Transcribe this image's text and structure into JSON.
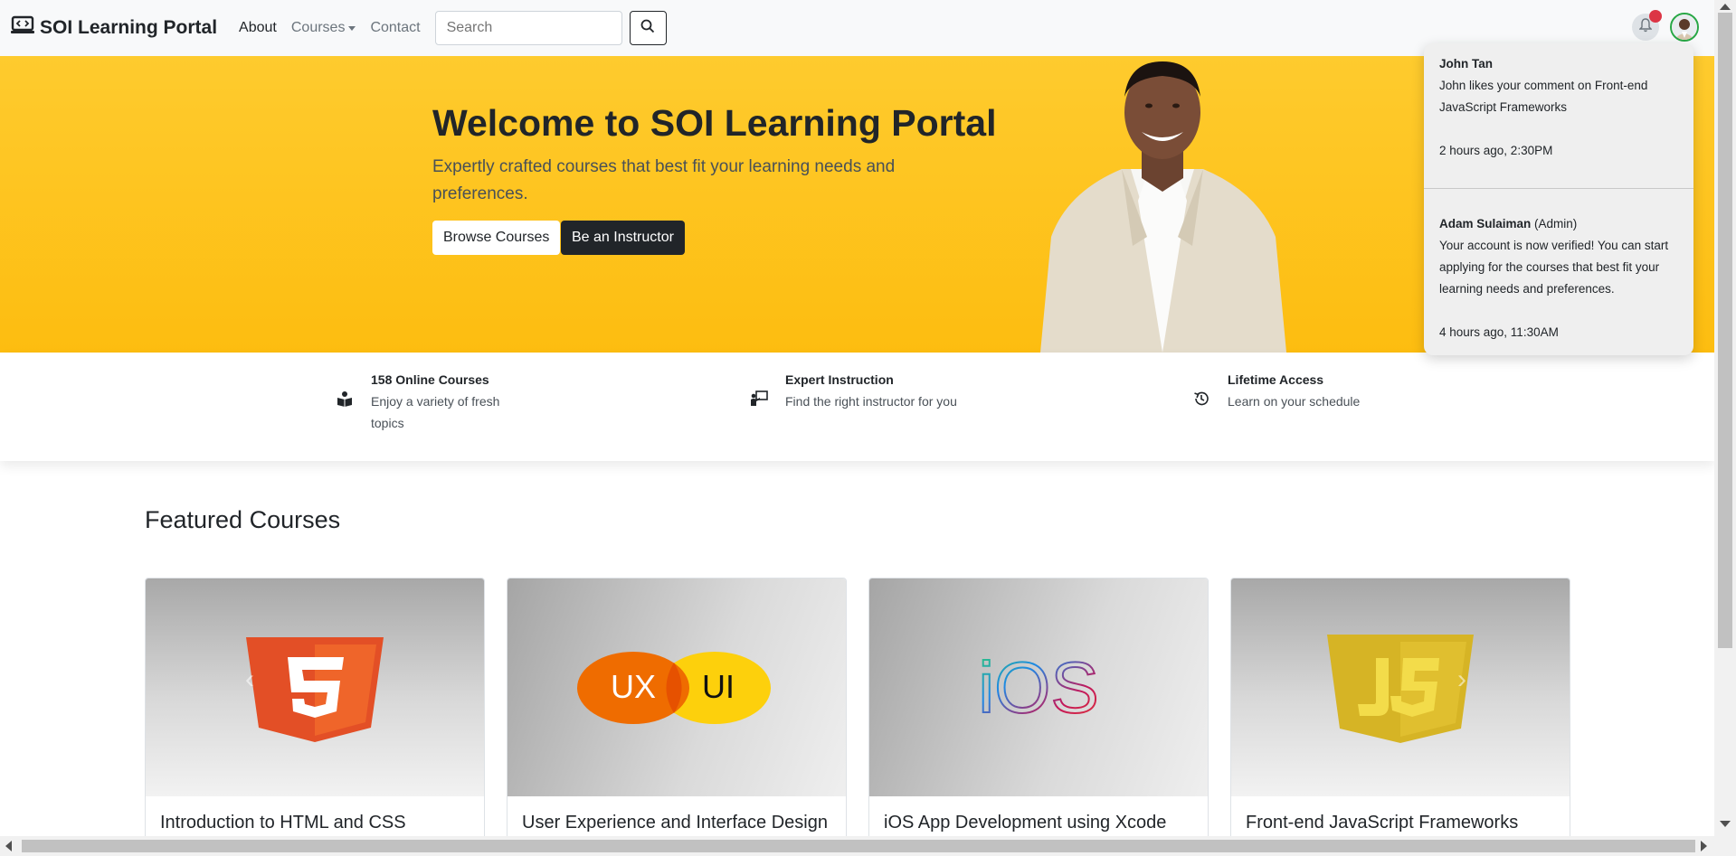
{
  "navbar": {
    "brand": "SOI Learning Portal",
    "links": [
      "About",
      "Courses",
      "Contact"
    ],
    "search_placeholder": "Search"
  },
  "hero": {
    "title": "Welcome to SOI Learning Portal",
    "subtitle": "Expertly crafted courses that best fit your learning needs and preferences.",
    "browse_label": "Browse Courses",
    "instructor_label": "Be an Instructor"
  },
  "features": [
    {
      "title": "158 Online Courses",
      "text": "Enjoy a variety of fresh topics",
      "icon": "book-reader-icon"
    },
    {
      "title": "Expert Instruction",
      "text": "Find the right instructor for you",
      "icon": "chalkboard-teacher-icon"
    },
    {
      "title": "Lifetime Access",
      "text": "Learn on your schedule",
      "icon": "history-icon"
    }
  ],
  "featured": {
    "title": "Featured Courses",
    "courses": [
      {
        "title": "Introduction to HTML and CSS",
        "icon": "html5-logo"
      },
      {
        "title": "User Experience and Interface Design",
        "icon": "ux-ui-logo"
      },
      {
        "title": "iOS App Development using Xcode",
        "icon": "ios-logo"
      },
      {
        "title": "Front-end JavaScript Frameworks",
        "icon": "js-logo"
      }
    ]
  },
  "notifications": [
    {
      "name": "John Tan",
      "role": "",
      "message": "John likes your comment on Front-end JavaScript Frameworks",
      "time": "2 hours ago, 2:30PM"
    },
    {
      "name": "Adam Sulaiman",
      "role": "(Admin)",
      "message": "Your account is now verified! You can start applying for the courses that best fit your learning needs and preferences.",
      "time": "4 hours ago, 11:30AM"
    }
  ],
  "logos": {
    "ux": "UX",
    "ui": "UI",
    "ios": "iOS"
  },
  "colors": {
    "hero_yellow": "#fdc41e",
    "dark": "#212529",
    "badge_red": "#dc3545",
    "avatar_ring": "#28a745"
  }
}
